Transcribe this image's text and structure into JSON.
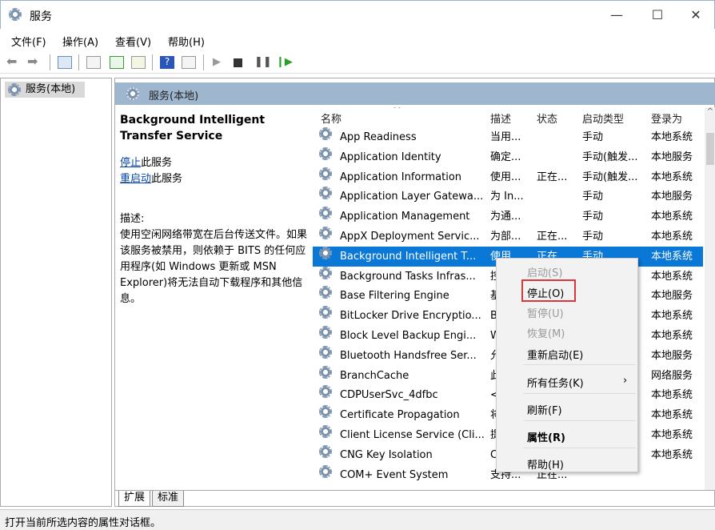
{
  "window": {
    "title": "服务",
    "minimize": "—",
    "maximize": "☐",
    "close": "✕"
  },
  "menu": [
    "文件(F)",
    "操作(A)",
    "查看(V)",
    "帮助(H)"
  ],
  "toolbar": [
    "back-icon",
    "forward-icon",
    "show-tree-icon",
    "properties-icon",
    "refresh-icon",
    "export-icon",
    "help-icon",
    "console-icon",
    "play-icon",
    "stop-icon",
    "pause-icon",
    "restart-icon"
  ],
  "tree": {
    "item": "服务(本地)"
  },
  "panel": {
    "title": "服务(本地)"
  },
  "details": {
    "service_name": "Background Intelligent Transfer Service",
    "stop_link": "停止",
    "stop_suffix": "此服务",
    "restart_link": "重启动",
    "restart_suffix": "此服务",
    "desc_label": "描述:",
    "description": "使用空闲网络带宽在后台传送文件。如果该服务被禁用，则依赖于 BITS 的任何应用程序(如 Windows 更新或 MSN Explorer)将无法自动下载程序和其他信息。"
  },
  "columns": [
    "名称",
    "描述",
    "状态",
    "启动类型",
    "登录为"
  ],
  "rows": [
    [
      "App Readiness",
      "当用...",
      "",
      "手动",
      "本地系统"
    ],
    [
      "Application Identity",
      "确定...",
      "",
      "手动(触发...",
      "本地服务"
    ],
    [
      "Application Information",
      "使用...",
      "正在...",
      "手动(触发...",
      "本地系统"
    ],
    [
      "Application Layer Gatewa...",
      "为 In...",
      "",
      "手动",
      "本地服务"
    ],
    [
      "Application Management",
      "为通...",
      "",
      "手动",
      "本地系统"
    ],
    [
      "AppX Deployment Servic...",
      "为部...",
      "正在...",
      "手动",
      "本地系统"
    ],
    [
      "Background Intelligent T...",
      "使用...",
      "正在...",
      "手动",
      "本地系统"
    ],
    [
      "Background Tasks Infras...",
      "控",
      "",
      "",
      "本地系统"
    ],
    [
      "Base Filtering Engine",
      "基",
      "",
      "",
      "本地服务"
    ],
    [
      "BitLocker Drive Encryptio...",
      "B",
      "",
      "",
      "本地系统"
    ],
    [
      "Block Level Backup Engi...",
      "W",
      "",
      "",
      "本地系统"
    ],
    [
      "Bluetooth Handsfree Ser...",
      "允",
      "",
      "",
      "本地服务"
    ],
    [
      "BranchCache",
      "此",
      "",
      "",
      "网络服务"
    ],
    [
      "CDPUserSvc_4dfbc",
      "<",
      "",
      "",
      "本地系统"
    ],
    [
      "Certificate Propagation",
      "将",
      "",
      "",
      "本地系统"
    ],
    [
      "Client License Service (Cli...",
      "提",
      "",
      "",
      "本地系统"
    ],
    [
      "CNG Key Isolation",
      "C",
      "",
      "",
      "本地系统"
    ],
    [
      "COM+ Event System",
      "支持...",
      "正在...",
      "",
      ""
    ]
  ],
  "selected_row": 6,
  "context_menu": [
    {
      "label": "启动(S)",
      "disabled": true
    },
    {
      "label": "停止(O)",
      "disabled": false,
      "highlighted": true
    },
    {
      "label": "暂停(U)",
      "disabled": true
    },
    {
      "label": "恢复(M)",
      "disabled": true
    },
    {
      "label": "重新启动(E)",
      "disabled": false
    },
    {
      "label": "所有任务(K)",
      "disabled": false,
      "submenu": true
    },
    {
      "label": "刷新(F)",
      "disabled": false
    },
    {
      "label": "属性(R)",
      "disabled": false,
      "bold": true
    },
    {
      "label": "帮助(H)",
      "disabled": false
    }
  ],
  "submenu_arrow": "›",
  "tabs": [
    "扩展",
    "标准"
  ],
  "statusbar": "打开当前所选内容的属性对话框。",
  "colors": {
    "selection": "#0a78d7",
    "band": "#9fb6cf",
    "highlight_box": "#d9363e",
    "link": "#0645ad"
  }
}
